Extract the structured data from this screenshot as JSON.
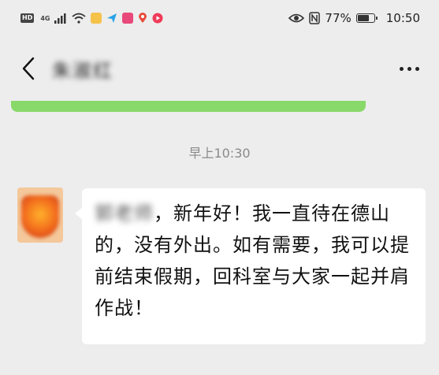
{
  "status_bar": {
    "hd": "HD",
    "network": "4G",
    "battery_percent": "77%",
    "battery_level": 0.77,
    "time": "10:50"
  },
  "header": {
    "contact_name": "朱淑红",
    "back_icon": "chevron-left-icon",
    "more_icon": "more-dots-icon"
  },
  "chat": {
    "timestamp": "早上10:30",
    "message": {
      "mention": "郭老师",
      "text": "，新年好！我一直待在德山的，没有外出。如有需要，我可以提前结束假期，回科室与大家一起并肩作战！"
    }
  },
  "colors": {
    "background": "#ededed",
    "bubble": "#ffffff",
    "green_bar": "#89d96a",
    "timestamp": "#8a8a8a"
  }
}
